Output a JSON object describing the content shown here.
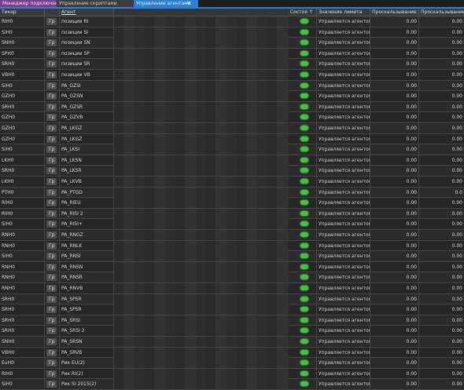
{
  "tabs": [
    {
      "label": "Менеджер подключений"
    },
    {
      "label": "Управление скриптами"
    },
    {
      "label": "Управление агентами"
    }
  ],
  "colors": {
    "accent": "#2f7fd0",
    "active_led": "#3cc83c",
    "tab1": "#7a3f8c"
  },
  "columns": {
    "ticker": "Тикер",
    "agent": "Агент",
    "state": "Состоя",
    "state_icon": "↑",
    "limit": "Значение лимита",
    "slip1": "Проскальзывание %",
    "slip2": "Проскальзывание"
  },
  "rows": [
    {
      "ticker": "RIH0",
      "gr": "Гр",
      "agent": "позиции RI",
      "limit": "Управляется агентом",
      "slip1": "0.00",
      "slip2": "0.00"
    },
    {
      "ticker": "SiH0",
      "gr": "Гр",
      "agent": "позиции SI",
      "limit": "Управляется агентом",
      "slip1": "0.00",
      "slip2": "0.00"
    },
    {
      "ticker": "SNH0",
      "gr": "Гр",
      "agent": "позиции SN",
      "limit": "Управляется агентом",
      "slip1": "0.00",
      "slip2": "0.00"
    },
    {
      "ticker": "SPH0",
      "gr": "Гр",
      "agent": "позиции SP",
      "limit": "Управляется агентом",
      "slip1": "0.00",
      "slip2": "0.00"
    },
    {
      "ticker": "SRH0",
      "gr": "Гр",
      "agent": "позиции SR",
      "limit": "Управляется агентом",
      "slip1": "0.00",
      "slip2": "0.00"
    },
    {
      "ticker": "VBH0",
      "gr": "Гр",
      "agent": "позиции VB",
      "limit": "Управляется агентом",
      "slip1": "0.00",
      "slip2": "0.00"
    },
    {
      "ticker": "SiH0",
      "gr": "Гр",
      "agent": "PA_GZSI",
      "limit": "Управляется агентом",
      "slip1": "0.00",
      "slip2": "0.00"
    },
    {
      "ticker": "GZH0",
      "gr": "Гр",
      "agent": "PA_GZSN",
      "limit": "Управляется агентом",
      "slip1": "0.00",
      "slip2": "0.00"
    },
    {
      "ticker": "SRH0",
      "gr": "Гр",
      "agent": "PA_GZSR",
      "limit": "Управляется агентом",
      "slip1": "0.00",
      "slip2": "0.00"
    },
    {
      "ticker": "GZH0",
      "gr": "Гр",
      "agent": "PA_GZVB",
      "limit": "Управляется агентом",
      "slip1": "0.00",
      "slip2": "0.00"
    },
    {
      "ticker": "GZH0",
      "gr": "Гр",
      "agent": "PA_LKGZ",
      "limit": "Управляется агентом",
      "slip1": "0.00",
      "slip2": "0.00"
    },
    {
      "ticker": "GZH0",
      "gr": "Гр",
      "agent": "PA_LKGZ",
      "limit": "Управляется агентом",
      "slip1": "0.00",
      "slip2": "0.00"
    },
    {
      "ticker": "SiH0",
      "gr": "Гр",
      "agent": "PA_LKSI",
      "limit": "Управляется агентом",
      "slip1": "0.00",
      "slip2": "0.00"
    },
    {
      "ticker": "LKH0",
      "gr": "Гр",
      "agent": "PA_LKSN",
      "limit": "Управляется агентом",
      "slip1": "0.00",
      "slip2": "0.00"
    },
    {
      "ticker": "SRH0",
      "gr": "Гр",
      "agent": "PA_LKSR",
      "limit": "Управляется агентом",
      "slip1": "0.00",
      "slip2": "0.00"
    },
    {
      "ticker": "LKH0",
      "gr": "Гр",
      "agent": "PA_LKVB",
      "limit": "Управляется агентом",
      "slip1": "0.00",
      "slip2": "0.00"
    },
    {
      "ticker": "PTH0",
      "gr": "Гр",
      "agent": "PA_PTGD",
      "limit": "Управляется агентом",
      "slip1": "0.00",
      "slip2": "0.0"
    },
    {
      "ticker": "RIH0",
      "gr": "Гр",
      "agent": "PA_RIEU",
      "limit": "Управляется агентом",
      "slip1": "0.00",
      "slip2": "0.00"
    },
    {
      "ticker": "RIH0",
      "gr": "Гр",
      "agent": "PA_RISI 2",
      "limit": "Управляется агентом",
      "slip1": "0.00",
      "slip2": "0.00"
    },
    {
      "ticker": "SiH0",
      "gr": "Гр",
      "agent": "PA_RISI+",
      "limit": "Управляется агентом",
      "slip1": "0.00",
      "slip2": "0.00"
    },
    {
      "ticker": "RNH0",
      "gr": "Гр",
      "agent": "PA_RNGZ",
      "limit": "Управляется агентом",
      "slip1": "0.00",
      "slip2": "0.00"
    },
    {
      "ticker": "RNH0",
      "gr": "Гр",
      "agent": "PA_RNLK",
      "limit": "Управляется агентом",
      "slip1": "0.00",
      "slip2": "0.00"
    },
    {
      "ticker": "SiH0",
      "gr": "Гр",
      "agent": "PA_RNSI",
      "limit": "Управляется агентом",
      "slip1": "0.00",
      "slip2": "0.00"
    },
    {
      "ticker": "RNH0",
      "gr": "Гр",
      "agent": "PA_RNSN",
      "limit": "Управляется агентом",
      "slip1": "0.00",
      "slip2": "0.00"
    },
    {
      "ticker": "RNH0",
      "gr": "Гр",
      "agent": "PA_RNSR",
      "limit": "Управляется агентом",
      "slip1": "0.00",
      "slip2": "0.00"
    },
    {
      "ticker": "RNH0",
      "gr": "Гр",
      "agent": "PA_RNVB",
      "limit": "Управляется агентом",
      "slip1": "0.00",
      "slip2": "0.00"
    },
    {
      "ticker": "SRH0",
      "gr": "Гр",
      "agent": "PA_SPSR",
      "limit": "Управляется агентом",
      "slip1": "0.00",
      "slip2": "0.00"
    },
    {
      "ticker": "SRH0",
      "gr": "Гр",
      "agent": "PA_SPSR",
      "limit": "Управляется агентом",
      "slip1": "0.00",
      "slip2": "0.00"
    },
    {
      "ticker": "SRH0",
      "gr": "Гр",
      "agent": "PA_SRSI",
      "limit": "Управляется агентом",
      "slip1": "0.00",
      "slip2": "0.00"
    },
    {
      "ticker": "SRH0",
      "gr": "Гр",
      "agent": "PA_SRSI 2",
      "limit": "Управляется агентом",
      "slip1": "0.00",
      "slip2": "0.00"
    },
    {
      "ticker": "SNH0",
      "gr": "Гр",
      "agent": "PA_SRSN",
      "limit": "Управляется агентом",
      "slip1": "0.00",
      "slip2": "0.00"
    },
    {
      "ticker": "VBH0",
      "gr": "Гр",
      "agent": "PA_SRVB",
      "limit": "Управляется агентом",
      "slip1": "0.00",
      "slip2": "0.00"
    },
    {
      "ticker": "EuH0",
      "gr": "Гр",
      "agent": "Рик EU(2)",
      "limit": "Управляется агентом",
      "slip1": "0.00",
      "slip2": "0.00"
    },
    {
      "ticker": "RIH0",
      "gr": "Гр",
      "agent": "Рик RI(2)",
      "limit": "Управляется агентом",
      "slip1": "0.00",
      "slip2": "0.00"
    },
    {
      "ticker": "SiH0",
      "gr": "Гр",
      "agent": "Рик SI 2015(2)",
      "limit": "Управляется агентом",
      "slip1": "0.00",
      "slip2": "0.00"
    }
  ]
}
